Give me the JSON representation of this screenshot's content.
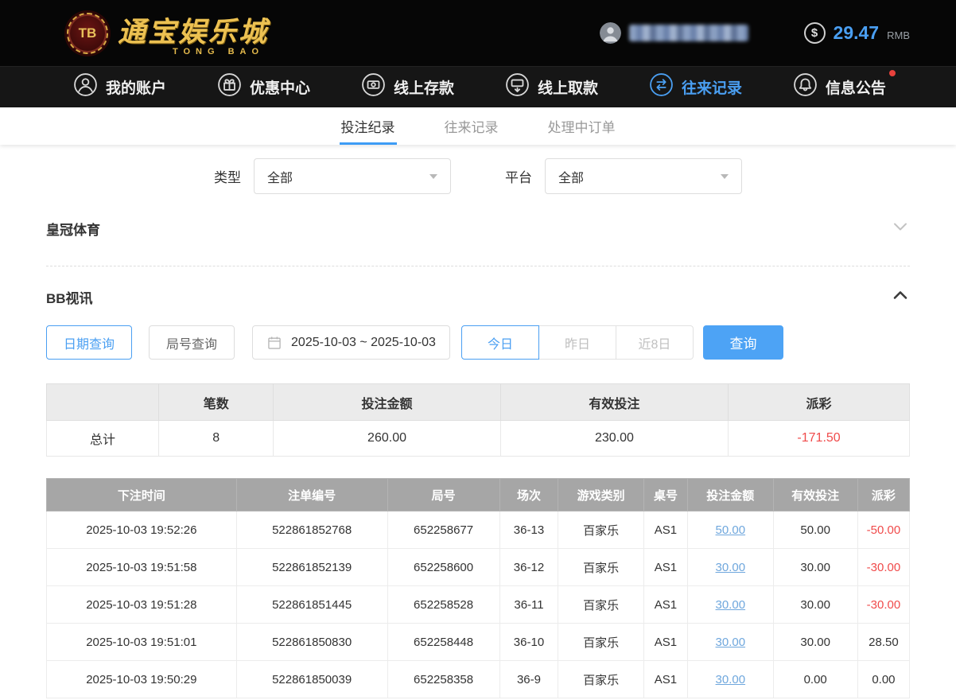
{
  "header": {
    "logo": {
      "chip": "TB",
      "title": "通宝娱乐城",
      "subtitle": "TONG BAO"
    },
    "balance": {
      "symbol": "$",
      "amount": "29.47",
      "currency": "RMB"
    }
  },
  "nav": {
    "items": [
      {
        "label": "我的账户"
      },
      {
        "label": "优惠中心"
      },
      {
        "label": "线上存款"
      },
      {
        "label": "线上取款"
      },
      {
        "label": "往来记录"
      },
      {
        "label": "信息公告"
      }
    ]
  },
  "tabs": [
    {
      "label": "投注纪录"
    },
    {
      "label": "往来记录"
    },
    {
      "label": "处理中订单"
    }
  ],
  "filters": {
    "type_label": "类型",
    "type_value": "全部",
    "platform_label": "平台",
    "platform_value": "全部"
  },
  "sections": [
    {
      "title": "皇冠体育"
    },
    {
      "title": "BB视讯"
    }
  ],
  "query": {
    "date_query": "日期查询",
    "round_query": "局号查询",
    "date_range": "2025-10-03 ~ 2025-10-03",
    "today": "今日",
    "yesterday": "昨日",
    "last8": "近8日",
    "search": "查询"
  },
  "summary": {
    "headers": [
      "",
      "笔数",
      "投注金额",
      "有效投注",
      "派彩"
    ],
    "row": {
      "label": "总计",
      "count": "8",
      "bet": "260.00",
      "valid": "230.00",
      "payout": "-171.50"
    }
  },
  "table": {
    "headers": [
      "下注时间",
      "注单编号",
      "局号",
      "场次",
      "游戏类别",
      "桌号",
      "投注金额",
      "有效投注",
      "派彩"
    ],
    "rows": [
      [
        "2025-10-03 19:52:26",
        "522861852768",
        "652258677",
        "36-13",
        "百家乐",
        "AS1",
        "50.00",
        "50.00",
        "-50.00"
      ],
      [
        "2025-10-03 19:51:58",
        "522861852139",
        "652258600",
        "36-12",
        "百家乐",
        "AS1",
        "30.00",
        "30.00",
        "-30.00"
      ],
      [
        "2025-10-03 19:51:28",
        "522861851445",
        "652258528",
        "36-11",
        "百家乐",
        "AS1",
        "30.00",
        "30.00",
        "-30.00"
      ],
      [
        "2025-10-03 19:51:01",
        "522861850830",
        "652258448",
        "36-10",
        "百家乐",
        "AS1",
        "30.00",
        "30.00",
        "28.50"
      ],
      [
        "2025-10-03 19:50:29",
        "522861850039",
        "652258358",
        "36-9",
        "百家乐",
        "AS1",
        "30.00",
        "0.00",
        "0.00"
      ]
    ]
  },
  "colors": {
    "accent": "#3d9cf5",
    "negative": "#f04b4b",
    "gold": "#ecc152"
  }
}
